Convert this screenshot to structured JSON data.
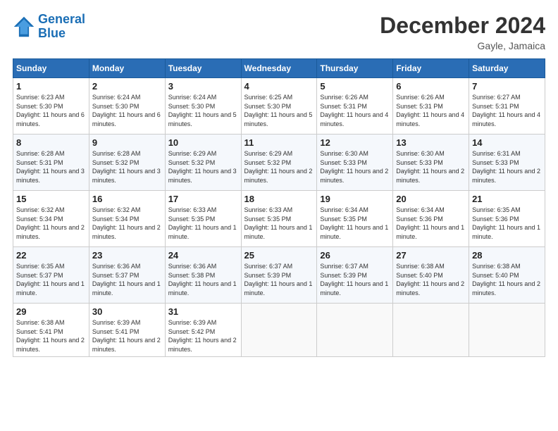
{
  "logo": {
    "line1": "General",
    "line2": "Blue"
  },
  "title": "December 2024",
  "subtitle": "Gayle, Jamaica",
  "weekdays": [
    "Sunday",
    "Monday",
    "Tuesday",
    "Wednesday",
    "Thursday",
    "Friday",
    "Saturday"
  ],
  "weeks": [
    [
      {
        "day": "1",
        "sunrise": "6:23 AM",
        "sunset": "5:30 PM",
        "daylight": "11 hours and 6 minutes."
      },
      {
        "day": "2",
        "sunrise": "6:24 AM",
        "sunset": "5:30 PM",
        "daylight": "11 hours and 6 minutes."
      },
      {
        "day": "3",
        "sunrise": "6:24 AM",
        "sunset": "5:30 PM",
        "daylight": "11 hours and 5 minutes."
      },
      {
        "day": "4",
        "sunrise": "6:25 AM",
        "sunset": "5:30 PM",
        "daylight": "11 hours and 5 minutes."
      },
      {
        "day": "5",
        "sunrise": "6:26 AM",
        "sunset": "5:31 PM",
        "daylight": "11 hours and 4 minutes."
      },
      {
        "day": "6",
        "sunrise": "6:26 AM",
        "sunset": "5:31 PM",
        "daylight": "11 hours and 4 minutes."
      },
      {
        "day": "7",
        "sunrise": "6:27 AM",
        "sunset": "5:31 PM",
        "daylight": "11 hours and 4 minutes."
      }
    ],
    [
      {
        "day": "8",
        "sunrise": "6:28 AM",
        "sunset": "5:31 PM",
        "daylight": "11 hours and 3 minutes."
      },
      {
        "day": "9",
        "sunrise": "6:28 AM",
        "sunset": "5:32 PM",
        "daylight": "11 hours and 3 minutes."
      },
      {
        "day": "10",
        "sunrise": "6:29 AM",
        "sunset": "5:32 PM",
        "daylight": "11 hours and 3 minutes."
      },
      {
        "day": "11",
        "sunrise": "6:29 AM",
        "sunset": "5:32 PM",
        "daylight": "11 hours and 2 minutes."
      },
      {
        "day": "12",
        "sunrise": "6:30 AM",
        "sunset": "5:33 PM",
        "daylight": "11 hours and 2 minutes."
      },
      {
        "day": "13",
        "sunrise": "6:30 AM",
        "sunset": "5:33 PM",
        "daylight": "11 hours and 2 minutes."
      },
      {
        "day": "14",
        "sunrise": "6:31 AM",
        "sunset": "5:33 PM",
        "daylight": "11 hours and 2 minutes."
      }
    ],
    [
      {
        "day": "15",
        "sunrise": "6:32 AM",
        "sunset": "5:34 PM",
        "daylight": "11 hours and 2 minutes."
      },
      {
        "day": "16",
        "sunrise": "6:32 AM",
        "sunset": "5:34 PM",
        "daylight": "11 hours and 2 minutes."
      },
      {
        "day": "17",
        "sunrise": "6:33 AM",
        "sunset": "5:35 PM",
        "daylight": "11 hours and 1 minute."
      },
      {
        "day": "18",
        "sunrise": "6:33 AM",
        "sunset": "5:35 PM",
        "daylight": "11 hours and 1 minute."
      },
      {
        "day": "19",
        "sunrise": "6:34 AM",
        "sunset": "5:35 PM",
        "daylight": "11 hours and 1 minute."
      },
      {
        "day": "20",
        "sunrise": "6:34 AM",
        "sunset": "5:36 PM",
        "daylight": "11 hours and 1 minute."
      },
      {
        "day": "21",
        "sunrise": "6:35 AM",
        "sunset": "5:36 PM",
        "daylight": "11 hours and 1 minute."
      }
    ],
    [
      {
        "day": "22",
        "sunrise": "6:35 AM",
        "sunset": "5:37 PM",
        "daylight": "11 hours and 1 minute."
      },
      {
        "day": "23",
        "sunrise": "6:36 AM",
        "sunset": "5:37 PM",
        "daylight": "11 hours and 1 minute."
      },
      {
        "day": "24",
        "sunrise": "6:36 AM",
        "sunset": "5:38 PM",
        "daylight": "11 hours and 1 minute."
      },
      {
        "day": "25",
        "sunrise": "6:37 AM",
        "sunset": "5:39 PM",
        "daylight": "11 hours and 1 minute."
      },
      {
        "day": "26",
        "sunrise": "6:37 AM",
        "sunset": "5:39 PM",
        "daylight": "11 hours and 1 minute."
      },
      {
        "day": "27",
        "sunrise": "6:38 AM",
        "sunset": "5:40 PM",
        "daylight": "11 hours and 2 minutes."
      },
      {
        "day": "28",
        "sunrise": "6:38 AM",
        "sunset": "5:40 PM",
        "daylight": "11 hours and 2 minutes."
      }
    ],
    [
      {
        "day": "29",
        "sunrise": "6:38 AM",
        "sunset": "5:41 PM",
        "daylight": "11 hours and 2 minutes."
      },
      {
        "day": "30",
        "sunrise": "6:39 AM",
        "sunset": "5:41 PM",
        "daylight": "11 hours and 2 minutes."
      },
      {
        "day": "31",
        "sunrise": "6:39 AM",
        "sunset": "5:42 PM",
        "daylight": "11 hours and 2 minutes."
      },
      null,
      null,
      null,
      null
    ]
  ]
}
